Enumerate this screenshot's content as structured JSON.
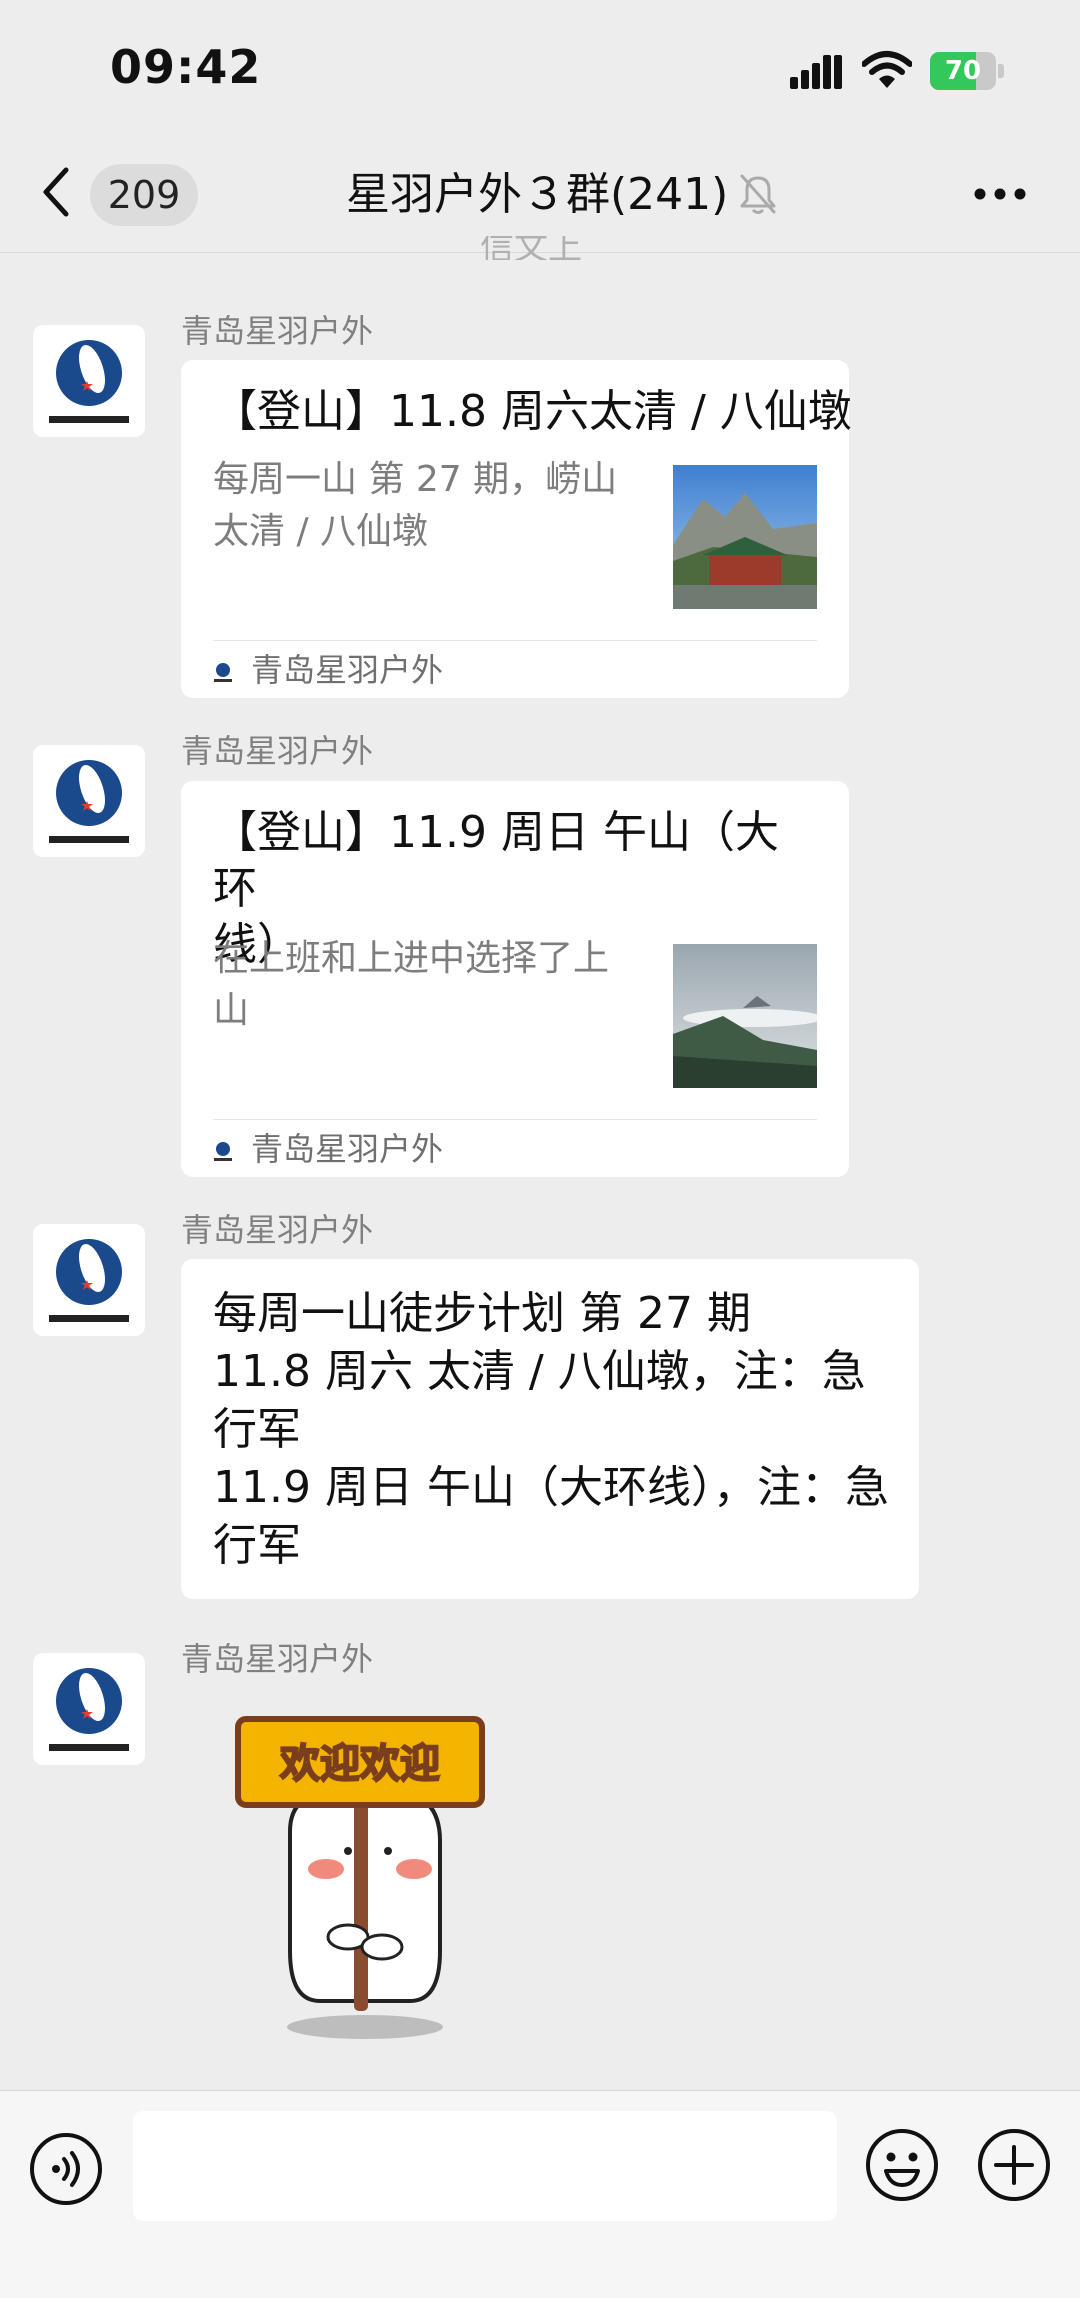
{
  "status_bar": {
    "time": "09:42",
    "battery": "70",
    "battery_level": 0.7
  },
  "nav": {
    "unread_count": "209",
    "title": "星羽户外３群(241)"
  },
  "chat": {
    "peek_text": "信文上",
    "messages": [
      {
        "sender": "青岛星羽户外",
        "kind": "link_card",
        "title": "【登山】11.8 周六太清 / 八仙墩",
        "desc_lines": [
          "每周一山 第 27 期，崂山",
          "太清 / 八仙墩"
        ],
        "source": "青岛星羽户外"
      },
      {
        "sender": "青岛星羽户外",
        "kind": "link_card",
        "title_lines": [
          "【登山】11.9 周日 午山（大环",
          "线）"
        ],
        "desc_lines": [
          "在上班和上进中选择了上",
          "山"
        ],
        "source": "青岛星羽户外"
      },
      {
        "sender": "青岛星羽户外",
        "kind": "text",
        "lines": [
          "每周一山徒步计划 第 27 期",
          "11.8 周六 太清 / 八仙墩，注：急",
          "行军",
          "11.9 周日 午山（大环线），注：急",
          "行军"
        ]
      },
      {
        "sender": "青岛星羽户外",
        "kind": "sticker",
        "sticker_text": "欢迎欢迎"
      }
    ]
  },
  "input": {
    "placeholder": ""
  },
  "icons": {
    "back": "chevron-left-icon",
    "mute": "bell-off-icon",
    "more": "more-icon",
    "voice": "voice-icon",
    "emoji": "emoji-icon",
    "plus": "plus-icon"
  },
  "colors": {
    "background": "#ededed",
    "bubble": "#ffffff",
    "battery": "#34c759",
    "sticker_sign": "#f5b400"
  }
}
